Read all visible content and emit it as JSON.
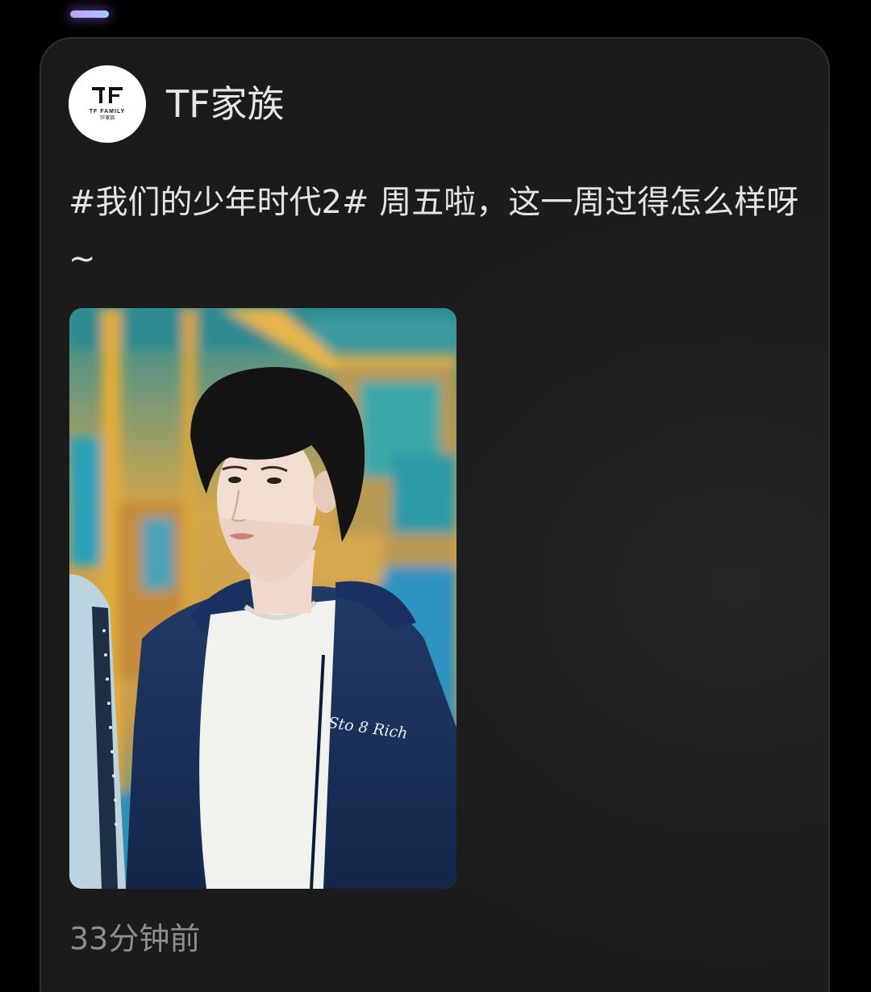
{
  "post": {
    "account_name": "TF家族",
    "avatar": {
      "logo_text": "TF FAMILY",
      "logo_sub": "TF家族"
    },
    "text": "#我们的少年时代2# 周五啦，这一周过得怎么样呀 ~",
    "image": {
      "jacket_print": "Sto 8 Rich"
    },
    "timestamp": "33分钟前"
  },
  "colors": {
    "background": "#000000",
    "card": "#1e1e1e",
    "primary_text": "#e4e4e4",
    "secondary_text": "#8e8e8e",
    "indicator": "#c39bff"
  },
  "icons": {
    "avatar": "tf-family-logo-icon"
  }
}
